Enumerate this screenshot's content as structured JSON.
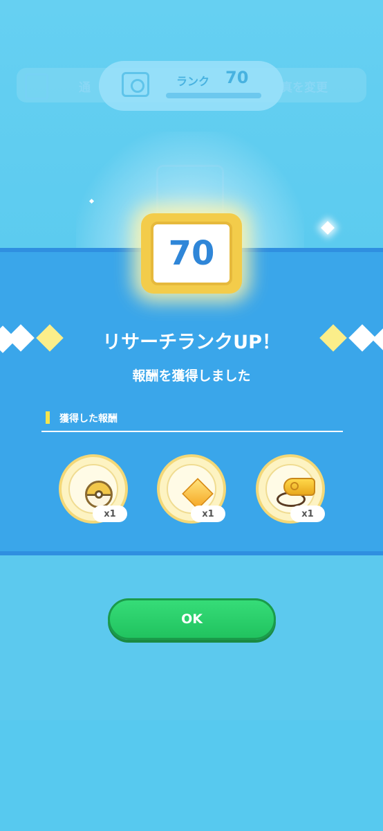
{
  "background": {
    "menu_left_fragment": "通",
    "menu_right_fragment": "真を変更"
  },
  "rank_header": {
    "label": "ランク",
    "value": "70"
  },
  "badge": {
    "rank_number": "70"
  },
  "panel": {
    "title": "リサーチランクUP！",
    "subtitle": "報酬を獲得しました",
    "rewards_section_label": "獲得した報酬",
    "rewards": [
      {
        "icon": "ultra-ball-icon",
        "quantity": "x1"
      },
      {
        "icon": "gem-icon",
        "quantity": "x1"
      },
      {
        "icon": "whistle-icon",
        "quantity": "x1"
      }
    ]
  },
  "ok_button": {
    "label": "OK"
  },
  "colors": {
    "panel_blue": "#3aa6ea",
    "rank_number": "#2f86d8",
    "ok_green": "#2bd06b",
    "badge_gold": "#f3cc4a"
  }
}
